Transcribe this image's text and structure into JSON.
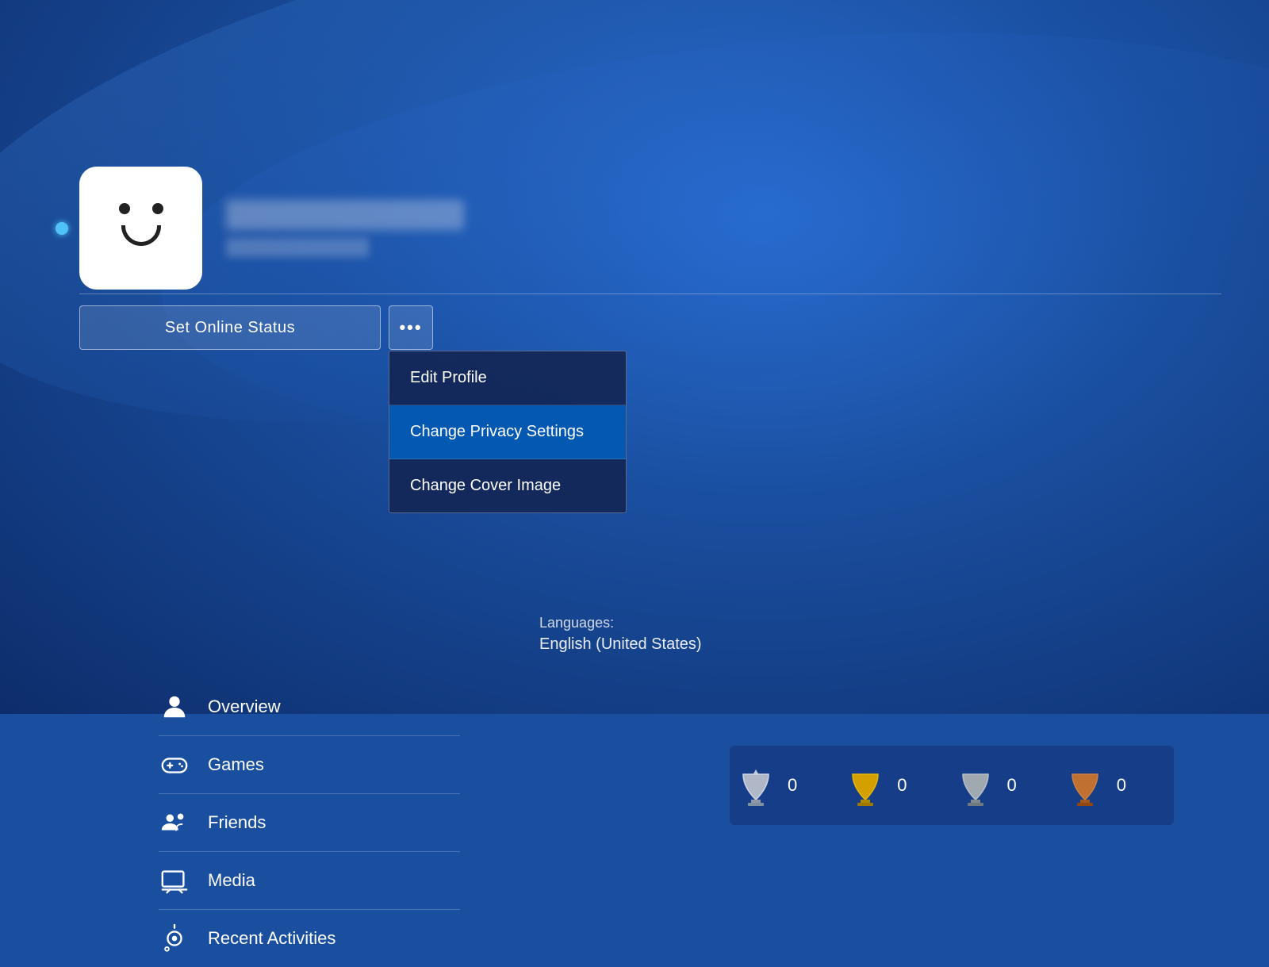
{
  "background": {
    "primary_color": "#1a4fa0",
    "secondary_color": "#0d2d6b"
  },
  "profile": {
    "online_status": "online",
    "username_blurred": true,
    "psn_blurred": true
  },
  "buttons": {
    "set_online_status": "Set Online Status",
    "more_dots": "•••"
  },
  "language_section": {
    "label": "Languages:",
    "value": "English (United States)"
  },
  "dropdown": {
    "items": [
      {
        "id": "edit-profile",
        "label": "Edit Profile",
        "active": false
      },
      {
        "id": "change-privacy",
        "label": "Change Privacy Settings",
        "active": true
      },
      {
        "id": "change-cover",
        "label": "Change Cover Image",
        "active": false
      }
    ]
  },
  "nav": {
    "items": [
      {
        "id": "overview",
        "label": "Overview",
        "icon": "person"
      },
      {
        "id": "games",
        "label": "Games",
        "icon": "gamepad"
      },
      {
        "id": "friends",
        "label": "Friends",
        "icon": "friends"
      },
      {
        "id": "media",
        "label": "Media",
        "icon": "media"
      },
      {
        "id": "recent-activities",
        "label": "Recent Activities",
        "icon": "recent"
      }
    ]
  },
  "trophies": [
    {
      "type": "platinum",
      "color": "#b0b8c8",
      "count": "0"
    },
    {
      "type": "gold",
      "color": "#d4a000",
      "count": "0"
    },
    {
      "type": "silver",
      "color": "#a0a8b0",
      "count": "0"
    },
    {
      "type": "bronze",
      "color": "#c07030",
      "count": "0"
    }
  ]
}
